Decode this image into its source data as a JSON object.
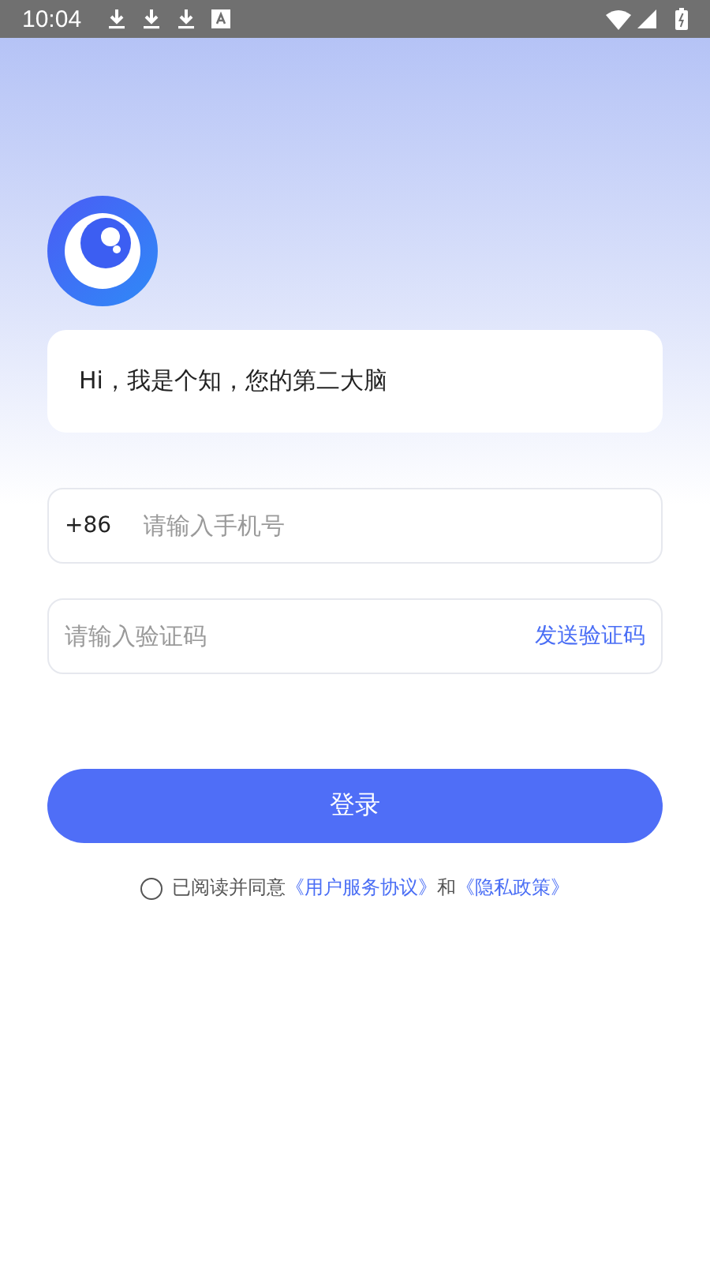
{
  "status_bar": {
    "time": "10:04",
    "notifications": [
      {
        "kind": "download"
      },
      {
        "kind": "download"
      },
      {
        "kind": "download"
      },
      {
        "kind": "app"
      }
    ]
  },
  "greeting": "Hi，我是个知，您的第二大脑",
  "phone_field": {
    "prefix": "+86",
    "placeholder": "请输入手机号"
  },
  "code_field": {
    "placeholder": "请输入验证码",
    "action": "发送验证码"
  },
  "login_button": "登录",
  "agreement": {
    "checked": false,
    "parts": [
      {
        "kind": "text",
        "text": "已阅读并同意"
      },
      {
        "kind": "link",
        "text": "《用户服务协议》"
      },
      {
        "kind": "text",
        "text": "和"
      },
      {
        "kind": "link",
        "text": "《隐私政策》"
      }
    ]
  }
}
